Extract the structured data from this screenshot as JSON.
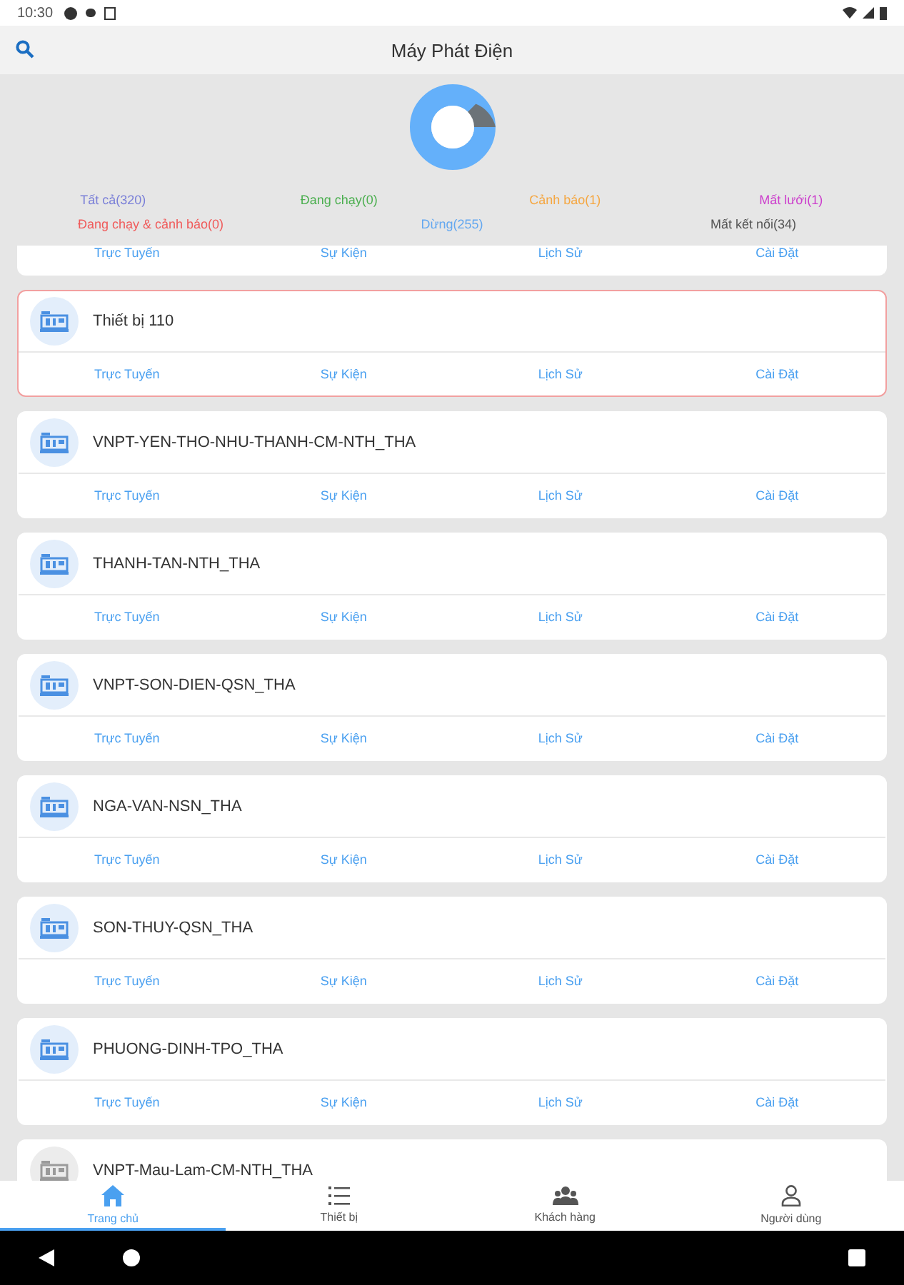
{
  "status_bar": {
    "time": "10:30"
  },
  "app_bar": {
    "title": "Máy Phát Điện"
  },
  "filters": [
    {
      "label": "Tất cả(320)",
      "color": "#7b80d8"
    },
    {
      "label": "Đang chạy(0)",
      "color": "#4caf50"
    },
    {
      "label": "Cảnh báo(1)",
      "color": "#f5a742"
    },
    {
      "label": "Mất lưới(1)",
      "color": "#cc3fcc"
    },
    {
      "label": "Đang chạy & cảnh báo(0)",
      "color": "#f05a5a"
    },
    {
      "label": "Dừng(255)",
      "color": "#64a8f0"
    },
    {
      "label": "Mất kết nối(34)",
      "color": "#555555"
    }
  ],
  "devices": [
    {
      "kind": "actions_only",
      "selected": false,
      "actions": [
        "Trực Tuyến",
        "Sự Kiện",
        "Lịch Sử",
        "Cài Đặt"
      ]
    },
    {
      "kind": "card",
      "name": "Thiết bị 110",
      "active": true,
      "selected": true,
      "actions": [
        "Trực Tuyến",
        "Sự Kiện",
        "Lịch Sử",
        "Cài Đặt"
      ]
    },
    {
      "kind": "card",
      "name": "VNPT-YEN-THO-NHU-THANH-CM-NTH_THA",
      "active": true,
      "selected": false,
      "actions": [
        "Trực Tuyến",
        "Sự Kiện",
        "Lịch Sử",
        "Cài Đặt"
      ]
    },
    {
      "kind": "card",
      "name": "THANH-TAN-NTH_THA",
      "active": true,
      "selected": false,
      "actions": [
        "Trực Tuyến",
        "Sự Kiện",
        "Lịch Sử",
        "Cài Đặt"
      ]
    },
    {
      "kind": "card",
      "name": "VNPT-SON-DIEN-QSN_THA",
      "active": true,
      "selected": false,
      "actions": [
        "Trực Tuyến",
        "Sự Kiện",
        "Lịch Sử",
        "Cài Đặt"
      ]
    },
    {
      "kind": "card",
      "name": "NGA-VAN-NSN_THA",
      "active": true,
      "selected": false,
      "actions": [
        "Trực Tuyến",
        "Sự Kiện",
        "Lịch Sử",
        "Cài Đặt"
      ]
    },
    {
      "kind": "card",
      "name": "SON-THUY-QSN_THA",
      "active": true,
      "selected": false,
      "actions": [
        "Trực Tuyến",
        "Sự Kiện",
        "Lịch Sử",
        "Cài Đặt"
      ]
    },
    {
      "kind": "card",
      "name": "PHUONG-DINH-TPO_THA",
      "active": true,
      "selected": false,
      "actions": [
        "Trực Tuyến",
        "Sự Kiện",
        "Lịch Sử",
        "Cài Đặt"
      ]
    },
    {
      "kind": "header_only",
      "name": "VNPT-Mau-Lam-CM-NTH_THA",
      "active": false,
      "selected": false
    }
  ],
  "bottom_nav": [
    {
      "label": "Trang chủ",
      "kind": "home",
      "selected": true
    },
    {
      "label": "Thiết bị",
      "kind": "list",
      "selected": false
    },
    {
      "label": "Khách hàng",
      "kind": "group",
      "selected": false
    },
    {
      "label": "Người dùng",
      "kind": "user",
      "selected": false
    }
  ]
}
